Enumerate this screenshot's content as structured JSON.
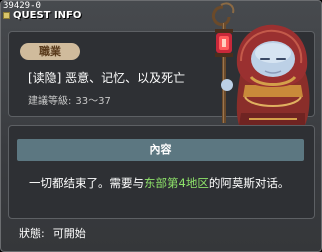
{
  "window": {
    "quest_id": "39429-0",
    "title": "QUEST INFO"
  },
  "quest": {
    "job_badge": "職業",
    "name": "[读隐] 恶意、记忆、以及死亡",
    "level_label": "建議等級:",
    "level_range": "33～37"
  },
  "content": {
    "header": "內容",
    "text_before": "一切都结束了。需要与",
    "highlight": "东部第4地区",
    "text_after": "的阿莫斯对话。"
  },
  "status": {
    "label": "狀態:",
    "value": "可開始"
  },
  "npc": {
    "icon": "hooded-mage-npc"
  },
  "colors": {
    "highlight": "#8ee36a",
    "badge_bg": "#d0bb9c",
    "content_header_bg": "#5c7781"
  }
}
